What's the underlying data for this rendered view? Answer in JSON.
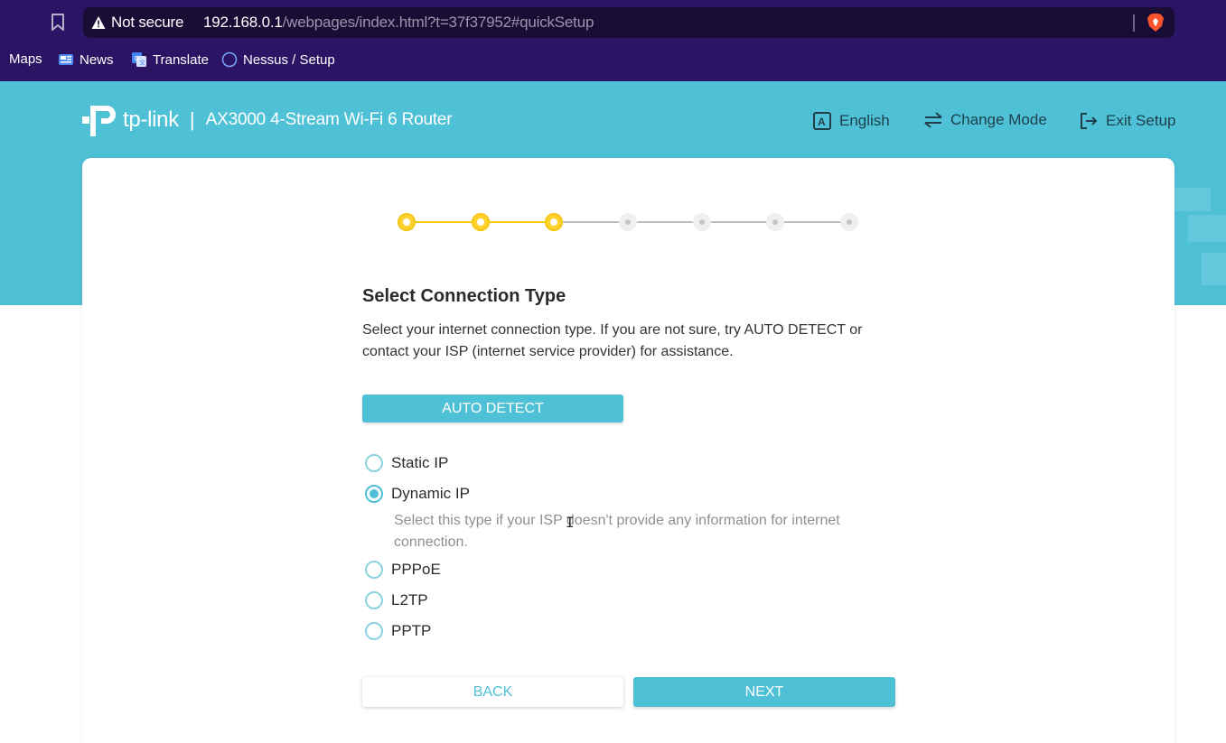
{
  "browser": {
    "security_label": "Not secure",
    "url_host": "192.168.0.1",
    "url_path": "/webpages/index.html?t=37f37952#quickSetup",
    "bookmarks": [
      {
        "label": "Maps",
        "icon": "maps-icon"
      },
      {
        "label": "News",
        "icon": "news-icon"
      },
      {
        "label": "Translate",
        "icon": "translate-icon"
      },
      {
        "label": "Nessus / Setup",
        "icon": "globe-icon"
      }
    ]
  },
  "header": {
    "brand": "tp-link",
    "divider": "|",
    "model": "AX3000 4-Stream Wi-Fi 6 Router",
    "language_label": "English",
    "change_mode_label": "Change Mode",
    "exit_setup_label": "Exit Setup"
  },
  "stepper": {
    "total_steps": 7,
    "completed_steps": 3
  },
  "main": {
    "title": "Select Connection Type",
    "description": "Select your internet connection type. If you are not sure, try AUTO DETECT or contact your ISP (internet service provider) for assistance.",
    "auto_detect_label": "AUTO DETECT",
    "options": [
      {
        "label": "Static IP",
        "checked": false
      },
      {
        "label": "Dynamic IP",
        "checked": true
      },
      {
        "label": "PPPoE",
        "checked": false
      },
      {
        "label": "L2TP",
        "checked": false
      },
      {
        "label": "PPTP",
        "checked": false
      }
    ],
    "dynamic_ip_hint": "Select this type if your ISP doesn't provide any information for internet connection.",
    "back_label": "BACK",
    "next_label": "NEXT"
  },
  "colors": {
    "brand": "#4ec1d6",
    "step_active": "#ffd22e",
    "browser_frame": "#2c1465"
  }
}
